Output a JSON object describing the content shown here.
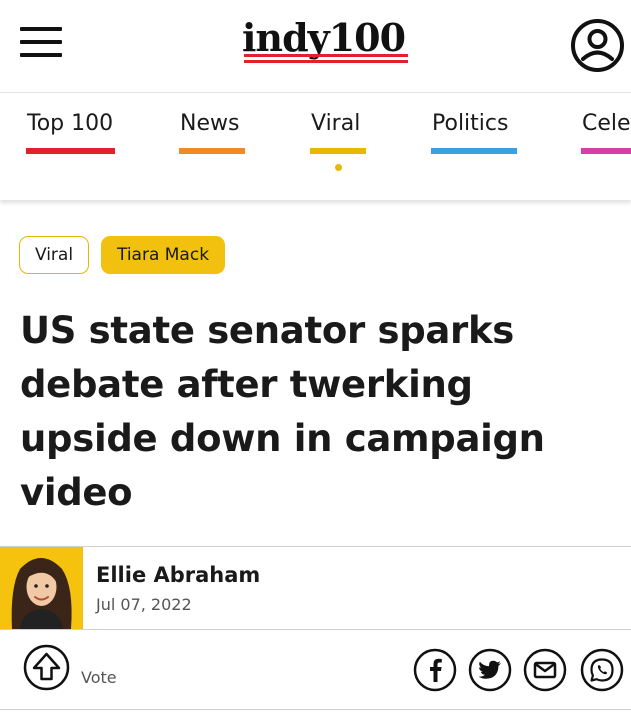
{
  "header": {
    "logo_text": "indy100",
    "brand_color": "#e0222d"
  },
  "nav": {
    "items": [
      {
        "label": "Top 100",
        "color": "#e0222d"
      },
      {
        "label": "News",
        "color": "#f08a24"
      },
      {
        "label": "Viral",
        "color": "#e6b800"
      },
      {
        "label": "Politics",
        "color": "#3aa0e0"
      },
      {
        "label": "Celeb",
        "color": "#d63fa5"
      }
    ],
    "active": "Viral"
  },
  "tags": {
    "section": "Viral",
    "person": "Tiara Mack"
  },
  "article": {
    "title_lines": [
      "US state senator sparks",
      "debate after twerking",
      "upside down in campaign",
      "video"
    ]
  },
  "author": {
    "name": "Ellie Abraham",
    "date": "Jul 07, 2022"
  },
  "actions": {
    "vote_label": "Vote",
    "share_icons": [
      "facebook-icon",
      "twitter-icon",
      "email-icon",
      "whatsapp-icon"
    ]
  }
}
